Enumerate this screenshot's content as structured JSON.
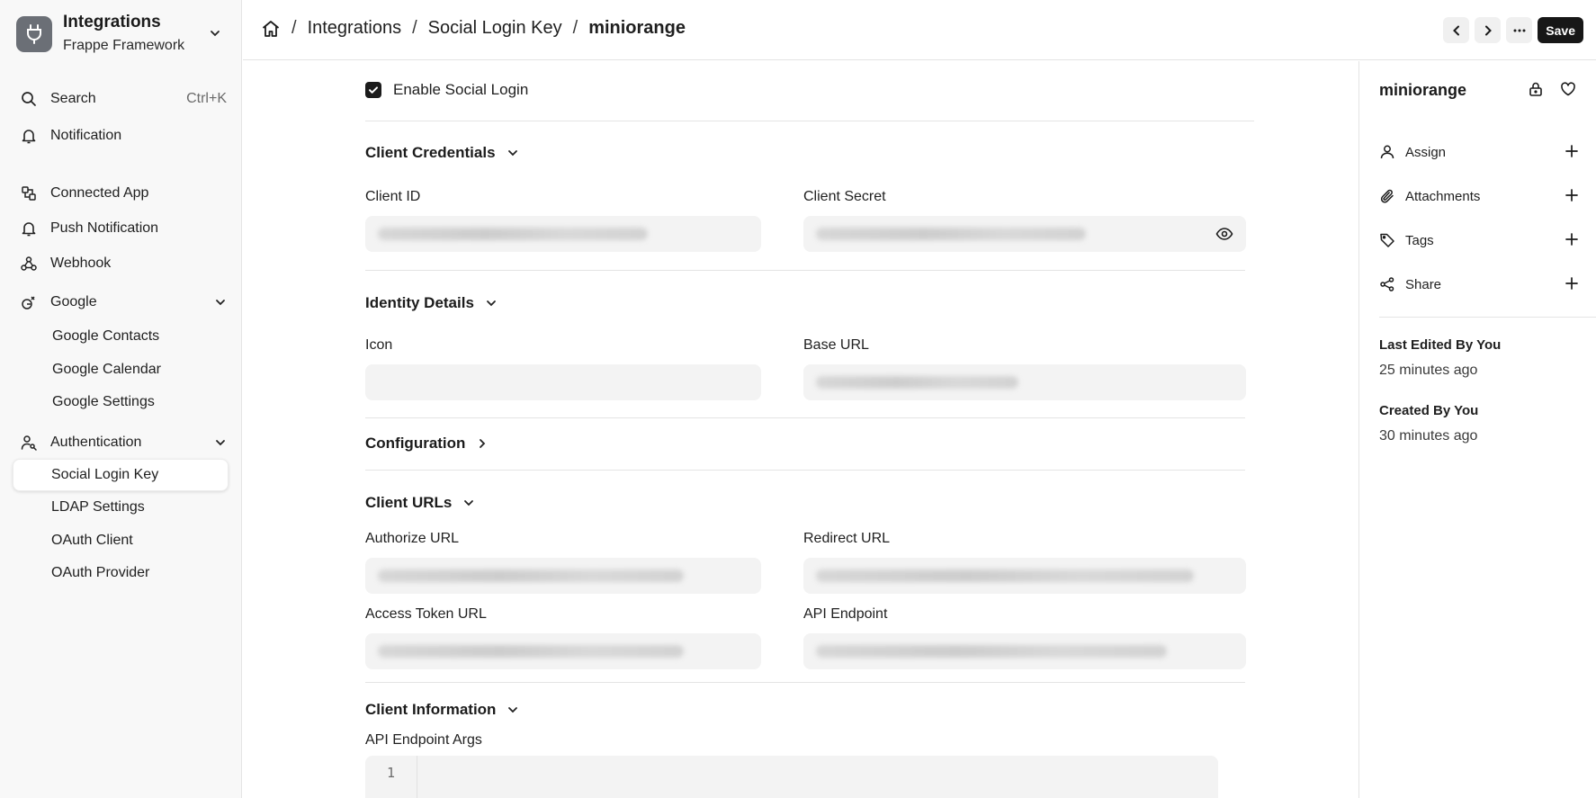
{
  "app": {
    "title": "Integrations",
    "subtitle": "Frappe Framework"
  },
  "sidebar": {
    "search": {
      "label": "Search",
      "shortcut": "Ctrl+K"
    },
    "notification": "Notification",
    "items": [
      {
        "label": "Connected App",
        "icon": "connected-app-icon"
      },
      {
        "label": "Push Notification",
        "icon": "bell-icon"
      },
      {
        "label": "Webhook",
        "icon": "webhook-icon"
      }
    ],
    "google": {
      "label": "Google",
      "children": [
        "Google Contacts",
        "Google Calendar",
        "Google Settings"
      ]
    },
    "authentication": {
      "label": "Authentication",
      "children": [
        "Social Login Key",
        "LDAP Settings",
        "OAuth Client",
        "OAuth Provider"
      ],
      "active": "Social Login Key"
    }
  },
  "breadcrumb": {
    "items": [
      "Integrations",
      "Social Login Key"
    ],
    "current": "miniorange",
    "separator": "/"
  },
  "toolbar": {
    "save_label": "Save"
  },
  "form": {
    "enable_social_login": {
      "label": "Enable Social Login",
      "checked": true
    },
    "sections": {
      "client_credentials": "Client Credentials",
      "identity_details": "Identity Details",
      "configuration": "Configuration",
      "client_urls": "Client URLs",
      "client_information": "Client Information"
    },
    "fields": {
      "client_id": "Client ID",
      "client_secret": "Client Secret",
      "icon": "Icon",
      "base_url": "Base URL",
      "authorize_url": "Authorize URL",
      "redirect_url": "Redirect URL",
      "access_token_url": "Access Token URL",
      "api_endpoint": "API Endpoint",
      "api_endpoint_args": "API Endpoint Args"
    },
    "code_line_number": "1"
  },
  "right_panel": {
    "title": "miniorange",
    "actions": [
      "Assign",
      "Attachments",
      "Tags",
      "Share"
    ],
    "last_edited": {
      "title": "Last Edited By You",
      "time": "25 minutes ago"
    },
    "created": {
      "title": "Created By You",
      "time": "30 minutes ago"
    }
  },
  "colors": {
    "accent": "#171717",
    "sidebar_bg": "#f8f8f8",
    "field_bg": "#f3f3f3",
    "border": "#e4e4e4"
  }
}
